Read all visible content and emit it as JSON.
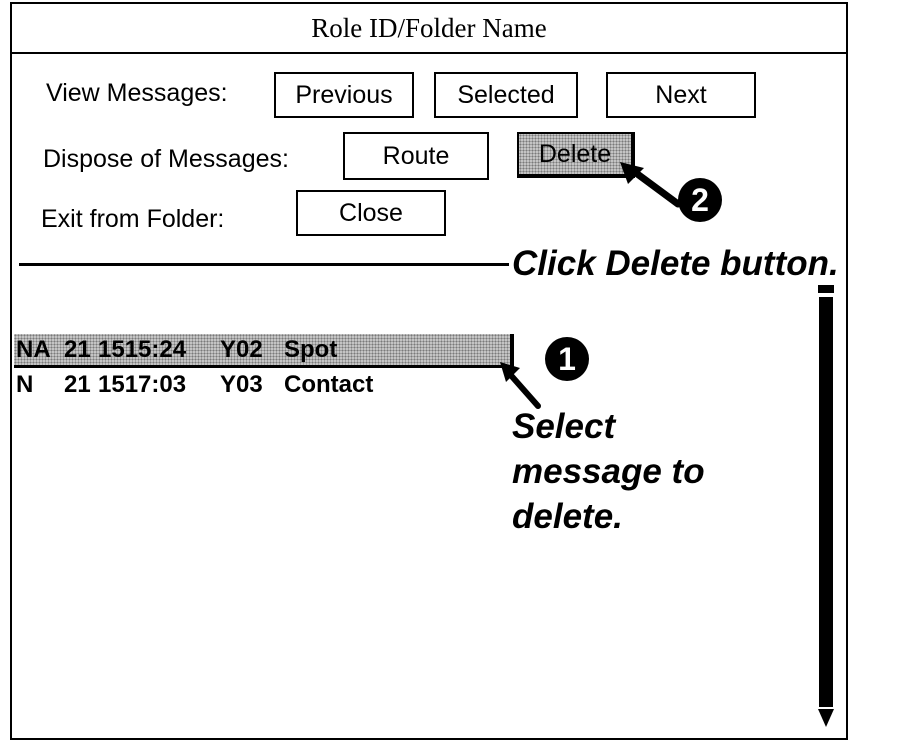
{
  "window": {
    "title": "Role ID/Folder Name"
  },
  "view_messages": {
    "label": "View Messages:",
    "previous": "Previous",
    "selected": "Selected",
    "next": "Next"
  },
  "dispose": {
    "label": "Dispose of Messages:",
    "route": "Route",
    "delete": "Delete"
  },
  "exit": {
    "label": "Exit from Folder:",
    "close": "Close"
  },
  "messages": [
    {
      "status": "NA",
      "day": "21",
      "time": "1515:24",
      "id": "Y02",
      "type": "Spot",
      "selected": true
    },
    {
      "status": "N",
      "day": "21",
      "time": "1517:03",
      "id": "Y03",
      "type": "Contact",
      "selected": false
    }
  ],
  "callouts": {
    "step1_number": "1",
    "step1_line1": "Select",
    "step1_line2": "message to",
    "step1_line3": "delete.",
    "step2_number": "2",
    "step2_text": "Click Delete button."
  }
}
